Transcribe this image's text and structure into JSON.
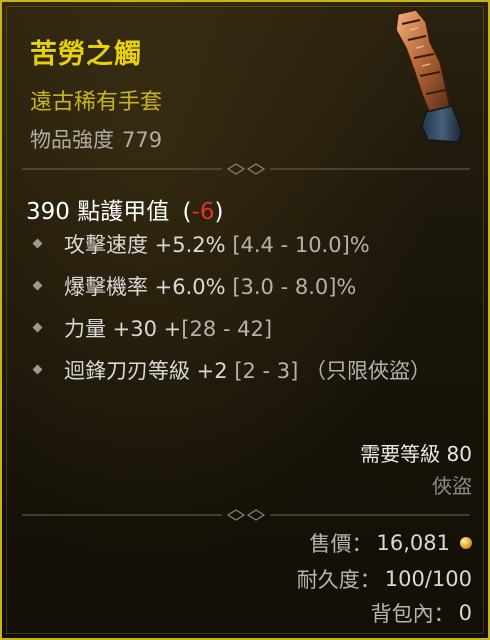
{
  "item": {
    "name": "苦勞之觸",
    "type": "遠古稀有手套",
    "power_label": "物品強度",
    "power_value": "779"
  },
  "armor": {
    "value": "390",
    "label": "點護甲值",
    "delta_open": "(",
    "delta_value": "-6",
    "delta_close": ")"
  },
  "affixes": [
    {
      "text": "攻擊速度 +5.2%",
      "range": "[4.4 - 10.0]%"
    },
    {
      "text": "爆擊機率 +6.0%",
      "range": "[3.0 - 8.0]%"
    },
    {
      "text": "力量 +30 +",
      "range": "[28 - 42]"
    },
    {
      "text": "迴鋒刀刃等級 +2",
      "range": "[2 - 3] （只限俠盜）"
    }
  ],
  "requirements": {
    "level_text": "需要等級 80",
    "class_text": "俠盜"
  },
  "footer": {
    "sell_label": "售價：",
    "sell_value": "16,081",
    "durability_label": "耐久度：",
    "durability_value": "100/100",
    "bag_label": "背包內：",
    "bag_value": "0"
  },
  "colors": {
    "legendary_yellow": "#e6d10c",
    "border": "#c8b414",
    "negative": "#e0332a"
  }
}
